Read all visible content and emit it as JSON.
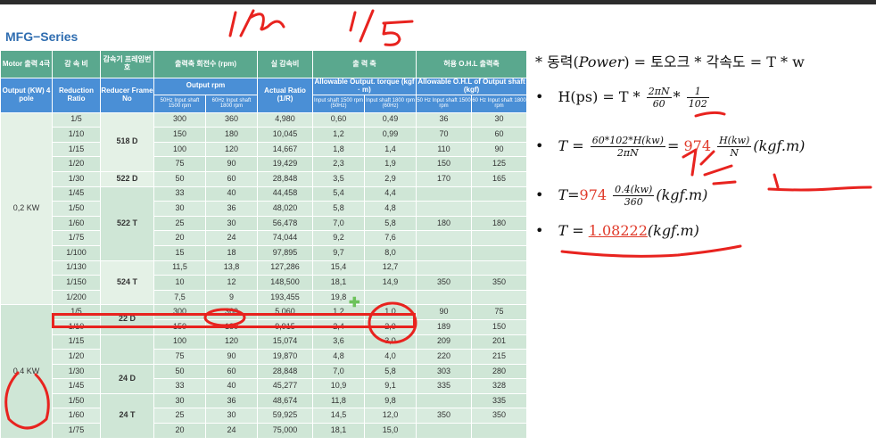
{
  "series_title": "MFG−Series",
  "header_row1": [
    "Motor 출력 4극",
    "감 속 비",
    "감속기 프레임번호",
    "출력축 회전수 (rpm)",
    "실 감속비",
    "출 력 축",
    "허용 O.H.L 출력축"
  ],
  "header_row2": [
    "Output (KW) 4 pole",
    "Reduction Ratio",
    "Reducer Frame No",
    "Output rpm",
    "Actual Ratio (1/R)",
    "Allowable Output. torque (kgf · m)",
    "Allowable O.H.L of Output shaft (kgf)"
  ],
  "header_row3": [
    "50Hz Input shaft 1500 rpm",
    "60Hz Input shaft 1800 rpm",
    "Input shaft 1500 rpm (50Hz)",
    "Input shaft 1800 rpm (60Hz)",
    "50 Hz Input shaft 1500 rpm",
    "60 Hz Input shaft 1800 rpm"
  ],
  "motors": [
    "0,2 KW",
    "0,4 KW"
  ],
  "frames": [
    "518 D",
    "522 D",
    "522 T",
    "524 T",
    "22 D",
    "24 D",
    "24 T"
  ],
  "rows": [
    [
      "1/5",
      "300",
      "360",
      "4,980",
      "0,60",
      "0,49",
      "36",
      "30"
    ],
    [
      "1/10",
      "150",
      "180",
      "10,045",
      "1,2",
      "0,99",
      "70",
      "60"
    ],
    [
      "1/15",
      "100",
      "120",
      "14,667",
      "1,8",
      "1,4",
      "110",
      "90"
    ],
    [
      "1/20",
      "75",
      "90",
      "19,429",
      "2,3",
      "1,9",
      "150",
      "125"
    ],
    [
      "1/30",
      "50",
      "60",
      "28,848",
      "3,5",
      "2,9",
      "170",
      "165"
    ],
    [
      "1/45",
      "33",
      "40",
      "44,458",
      "5,4",
      "4,4",
      "",
      ""
    ],
    [
      "1/50",
      "30",
      "36",
      "48,020",
      "5,8",
      "4,8",
      "",
      ""
    ],
    [
      "1/60",
      "25",
      "30",
      "56,478",
      "7,0",
      "5,8",
      "180",
      "180"
    ],
    [
      "1/75",
      "20",
      "24",
      "74,044",
      "9,2",
      "7,6",
      "",
      ""
    ],
    [
      "1/100",
      "15",
      "18",
      "97,895",
      "9,7",
      "8,0",
      "",
      ""
    ],
    [
      "1/130",
      "11,5",
      "13,8",
      "127,286",
      "15,4",
      "12,7",
      "",
      ""
    ],
    [
      "1/150",
      "10",
      "12",
      "148,500",
      "18,1",
      "14,9",
      "350",
      "350"
    ],
    [
      "1/200",
      "7,5",
      "9",
      "193,455",
      "19,8",
      "",
      "",
      " "
    ],
    [
      "1/5",
      "300",
      "360",
      "5,060",
      "1,2",
      "1,0",
      "90",
      "75"
    ],
    [
      "1/10",
      "150",
      "180",
      "9,915",
      "2,4",
      "2,0",
      "189",
      "150"
    ],
    [
      "1/15",
      "100",
      "120",
      "15,074",
      "3,6",
      "3,0",
      "209",
      "201"
    ],
    [
      "1/20",
      "75",
      "90",
      "19,870",
      "4,8",
      "4,0",
      "220",
      "215"
    ],
    [
      "1/30",
      "50",
      "60",
      "28,848",
      "7,0",
      "5,8",
      "303",
      "280"
    ],
    [
      "1/45",
      "33",
      "40",
      "45,277",
      "10,9",
      "9,1",
      "335",
      "328"
    ],
    [
      "1/50",
      "30",
      "36",
      "48,674",
      "11,8",
      "9,8",
      "",
      "335"
    ],
    [
      "1/60",
      "25",
      "30",
      "59,925",
      "14,5",
      "12,0",
      "350",
      "350"
    ],
    [
      "1/75",
      "20",
      "24",
      "75,000",
      "18,1",
      "15,0",
      "",
      ""
    ]
  ],
  "formulas": {
    "power_label": "* 동력(",
    "power_var": "Power",
    "power_rest": ") = 토오크 * 각속도 = T * w",
    "hps_left": "H(ps) = T *",
    "hps_frac1_num": "2πN",
    "hps_frac1_den": "60",
    "hps_frac2_num": "1",
    "hps_frac2_den": "102",
    "t_left": "T =",
    "t_frac_num": "60*102*H(kw)",
    "t_frac_den": "2πN",
    "t_eq": "=",
    "t_const": "974",
    "t_frac2_num": "H(kw)",
    "t_frac2_den": "N",
    "t_unit": "(kgf.m)",
    "t2_left": "T=",
    "t2_const": "974",
    "t2_frac_num": "0.4(kw)",
    "t2_frac_den": "360",
    "t2_unit": "(kgf.m)",
    "t3_left": "T =",
    "t3_value": "1.08222",
    "t3_unit": "(kgf.m)"
  },
  "handwritten": [
    "1/5"
  ],
  "colors": {
    "header_green": "#5aa88e",
    "header_blue": "#4a8fd6",
    "cell_green": "#d8ebde",
    "ink_red": "#e8231f",
    "accent_red": "#e03a2a",
    "title_blue": "#2f6db0"
  }
}
